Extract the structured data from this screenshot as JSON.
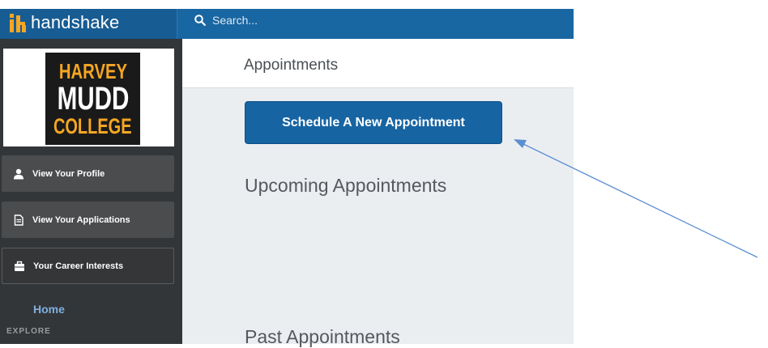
{
  "brand": {
    "name": "handshake"
  },
  "search": {
    "placeholder": "Search..."
  },
  "sidebar": {
    "logo": [
      "HARVEY",
      "MUDD",
      "COLLEGE"
    ],
    "items": [
      {
        "label": "View Your Profile",
        "icon": "user-icon"
      },
      {
        "label": "View Your Applications",
        "icon": "document-icon"
      },
      {
        "label": "Your Career Interests",
        "icon": "briefcase-icon"
      }
    ],
    "home": "Home",
    "section": "EXPLORE"
  },
  "header": {
    "title": "Appointments"
  },
  "main": {
    "schedule_label": "Schedule A New Appointment",
    "upcoming_title": "Upcoming Appointments",
    "past_title": "Past Appointments"
  },
  "colors": {
    "topbar": "#1866a2",
    "sidebar": "#333638",
    "button": "#1764a3",
    "logo_orange": "#f5a623",
    "annotation_arrow": "#5b8fcf"
  }
}
